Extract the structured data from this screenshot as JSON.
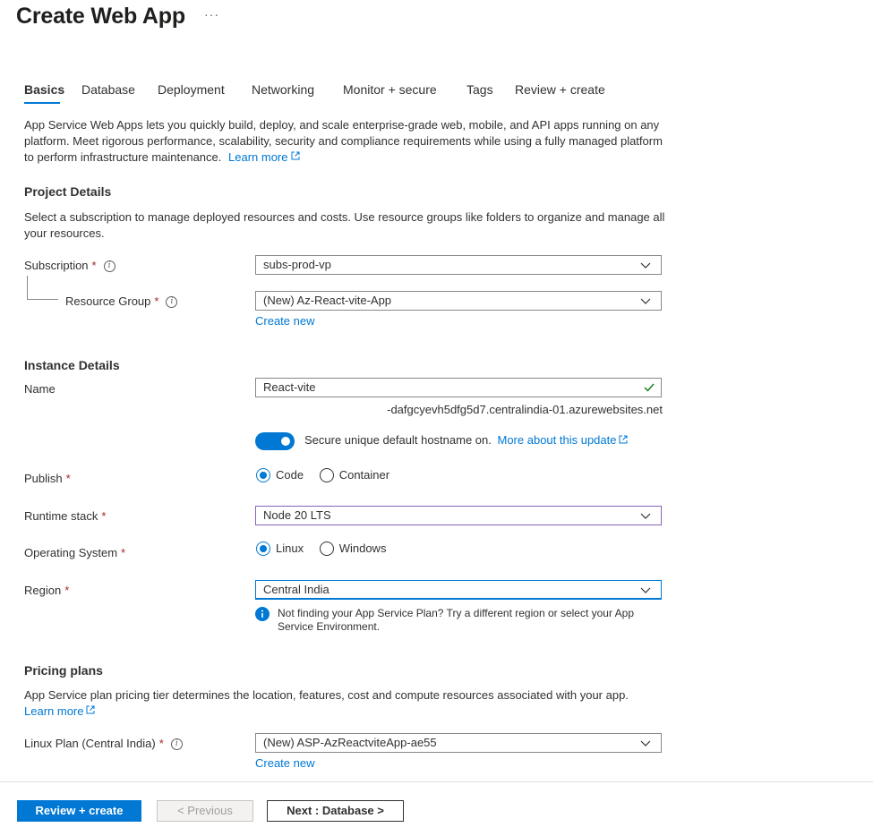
{
  "page": {
    "title": "Create Web App",
    "more": "···"
  },
  "tabs": [
    {
      "label": "Basics"
    },
    {
      "label": "Database"
    },
    {
      "label": "Deployment"
    },
    {
      "label": "Networking"
    },
    {
      "label": "Monitor + secure"
    },
    {
      "label": "Tags"
    },
    {
      "label": "Review + create"
    }
  ],
  "intro": {
    "text": "App Service Web Apps lets you quickly build, deploy, and scale enterprise-grade web, mobile, and API apps running on any platform. Meet rigorous performance, scalability, security and compliance requirements while using a fully managed platform to perform infrastructure maintenance.",
    "learn_more": "Learn more"
  },
  "project": {
    "heading": "Project Details",
    "description": "Select a subscription to manage deployed resources and costs. Use resource groups like folders to organize and manage all your resources.",
    "subscription_label": "Subscription",
    "subscription_value": "subs-prod-vp",
    "rg_label": "Resource Group",
    "rg_value": "(New) Az-React-vite-App",
    "create_new": "Create new"
  },
  "instance": {
    "heading": "Instance Details",
    "name_label": "Name",
    "name_value": "React-vite",
    "hostname_suffix": "-dafgcyevh5dfg5d7.centralindia-01.azurewebsites.net",
    "toggle_text": "Secure unique default hostname on.",
    "toggle_link": "More about this update",
    "publish_label": "Publish",
    "publish_options": [
      "Code",
      "Container"
    ],
    "runtime_label": "Runtime stack",
    "runtime_value": "Node 20 LTS",
    "os_label": "Operating System",
    "os_options": [
      "Linux",
      "Windows"
    ],
    "region_label": "Region",
    "region_value": "Central India",
    "region_info": "Not finding your App Service Plan? Try a different region or select your App Service Environment."
  },
  "pricing": {
    "heading": "Pricing plans",
    "description": "App Service plan pricing tier determines the location, features, cost and compute resources associated with your app.",
    "learn_more": "Learn more",
    "plan_label": "Linux Plan (Central India)",
    "plan_value": "(New) ASP-AzReactviteApp-ae55",
    "create_new": "Create new"
  },
  "footer": {
    "review_create": "Review + create",
    "previous": "< Previous",
    "next": "Next : Database >"
  },
  "colors": {
    "accent": "#0078d4",
    "required": "#a4262c",
    "valid": "#107c10"
  }
}
